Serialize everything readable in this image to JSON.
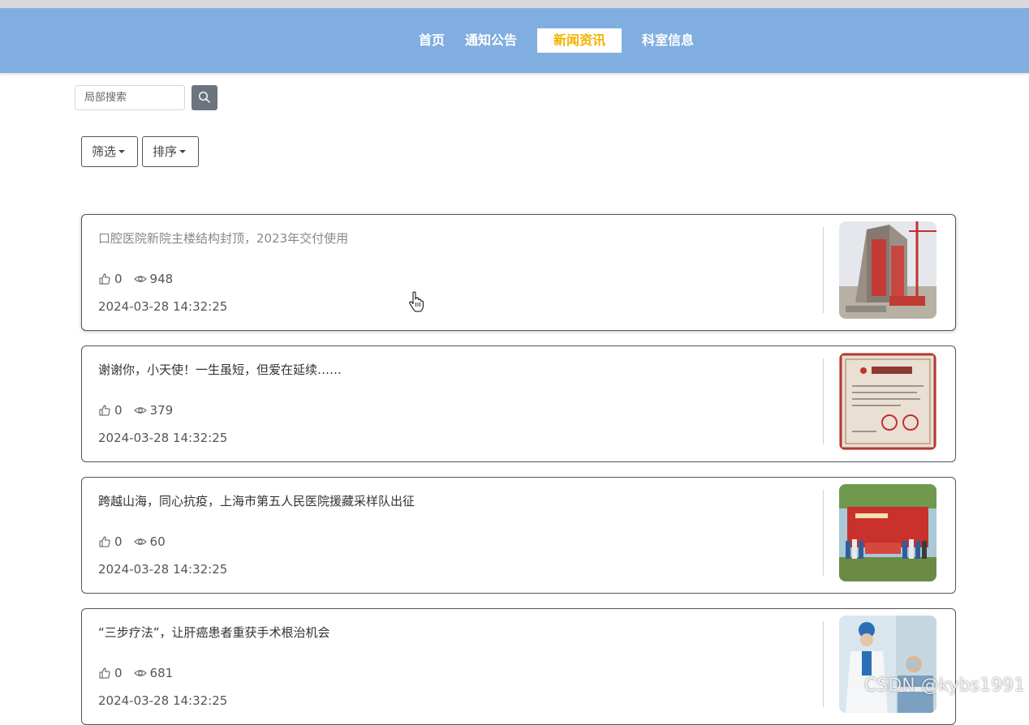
{
  "nav": {
    "items": [
      {
        "label": "首页",
        "active": false
      },
      {
        "label": "通知公告",
        "active": false
      },
      {
        "label": "新闻资讯",
        "active": true
      },
      {
        "label": "科室信息",
        "active": false
      }
    ],
    "colors": {
      "bar": "#80aee0",
      "active_text": "#f0b400"
    }
  },
  "search": {
    "placeholder": "局部搜索",
    "button_icon": "search-icon"
  },
  "filters": {
    "filter_label": "筛选",
    "sort_label": "排序"
  },
  "news": [
    {
      "title": "口腔医院新院主楼结构封顶，2023年交付使用",
      "likes": "0",
      "views": "948",
      "date": "2024-03-28 14:32:25",
      "image": "building-construction-photo"
    },
    {
      "title": "谢谢你，小天使！一生虽短，但爱在延续……",
      "likes": "0",
      "views": "379",
      "date": "2024-03-28 14:32:25",
      "image": "donation-certificate-photo"
    },
    {
      "title": "跨越山海，同心抗疫，上海市第五人民医院援藏采样队出征",
      "likes": "0",
      "views": "60",
      "date": "2024-03-28 14:32:25",
      "image": "medical-team-group-photo"
    },
    {
      "title": "“三步疗法”，让肝癌患者重获手术根治机会",
      "likes": "0",
      "views": "681",
      "date": "2024-03-28 14:32:25",
      "image": "doctor-with-patient-photo"
    }
  ],
  "watermark": "CSDN @kybs1991",
  "icons": {
    "like": "thumb-up-icon",
    "views": "eye-icon"
  }
}
